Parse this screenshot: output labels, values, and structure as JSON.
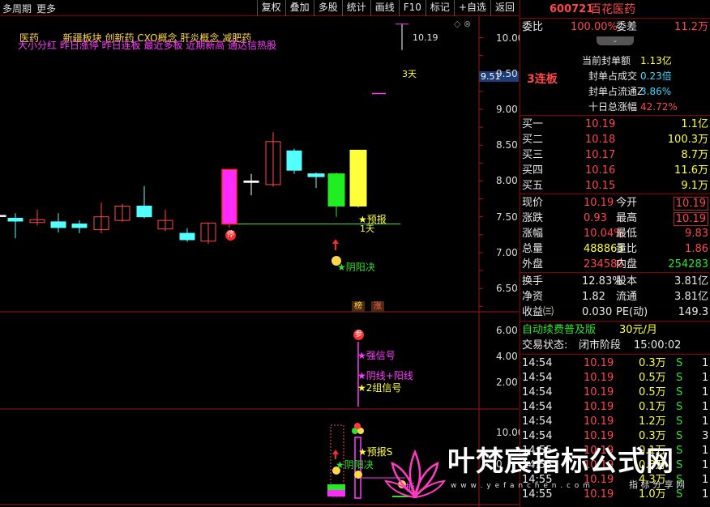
{
  "toolbar": {
    "period": "多周期",
    "more": "更多",
    "tools": [
      "复权",
      "叠加",
      "多股",
      "统计",
      "画线",
      "F10",
      "标记",
      "+自选",
      "返回"
    ]
  },
  "window_controls": "◇ ⊗",
  "chart": {
    "header_line1": {
      "sector": "医药",
      "concepts": "新疆板块  创新药 CXO概念 肝炎概念 减肥药"
    },
    "header_line2": "大小分红 昨日涨停 昨日连板 最近多板 近期新高 通达信热股",
    "price_labels": {
      "high_marker": "10.19",
      "limit_price": "9.51",
      "days": "3天",
      "forecast": "预报",
      "forecast_day": "1天",
      "yinyang": "阴阳决",
      "ting": "停",
      "b1": "榜",
      "b2": "涨"
    },
    "price_axis": [
      "10.00",
      "9.50",
      "9.00",
      "8.50",
      "8.00",
      "7.50",
      "7.00",
      "6.50"
    ],
    "signal_panel": {
      "badge": "参",
      "strong": "强信号",
      "yinyang_line": "阴线+阳线",
      "group": "2组信号",
      "axis": [
        "6.00",
        "4.00",
        "2.00"
      ]
    },
    "bottom_panel": {
      "forecast_s": "预报S",
      "yinyang": "阴阳决",
      "ban": "板",
      "axis": "10.00",
      "axis2": "0"
    },
    "chart_data": {
      "type": "candlestick",
      "ylim": [
        6.4,
        10.3
      ],
      "candles": [
        {
          "o": 7.52,
          "c": 7.52,
          "h": 7.62,
          "l": 7.35,
          "color": "white"
        },
        {
          "o": 7.44,
          "c": 7.48,
          "h": 7.55,
          "l": 7.2,
          "color": "cyan"
        },
        {
          "o": 7.42,
          "c": 7.46,
          "h": 7.6,
          "l": 7.38,
          "color": "red"
        },
        {
          "o": 7.43,
          "c": 7.35,
          "h": 7.55,
          "l": 7.28,
          "color": "cyan"
        },
        {
          "o": 7.4,
          "c": 7.35,
          "h": 7.45,
          "l": 7.27,
          "color": "cyan"
        },
        {
          "o": 7.32,
          "c": 7.5,
          "h": 7.7,
          "l": 7.27,
          "color": "red"
        },
        {
          "o": 7.45,
          "c": 7.65,
          "h": 7.68,
          "l": 7.43,
          "color": "red"
        },
        {
          "o": 7.65,
          "c": 7.5,
          "h": 7.93,
          "l": 7.48,
          "color": "cyan"
        },
        {
          "o": 7.33,
          "c": 7.45,
          "h": 7.6,
          "l": 7.3,
          "color": "red"
        },
        {
          "o": 7.27,
          "c": 7.18,
          "h": 7.34,
          "l": 7.15,
          "color": "cyan"
        },
        {
          "o": 7.16,
          "c": 7.41,
          "h": 7.42,
          "l": 7.12,
          "color": "red"
        },
        {
          "o": 7.4,
          "c": 8.15,
          "h": 8.16,
          "l": 7.35,
          "color": "magenta"
        },
        {
          "o": 7.98,
          "c": 8.0,
          "h": 8.1,
          "l": 7.8,
          "color": "white"
        },
        {
          "o": 7.95,
          "c": 8.55,
          "h": 8.68,
          "l": 7.92,
          "color": "red"
        },
        {
          "o": 8.42,
          "c": 8.15,
          "h": 8.45,
          "l": 8.1,
          "color": "cyan"
        },
        {
          "o": 8.1,
          "c": 8.06,
          "h": 8.12,
          "l": 7.9,
          "color": "cyan"
        },
        {
          "o": 7.65,
          "c": 8.1,
          "h": 8.12,
          "l": 7.5,
          "color": "green"
        },
        {
          "o": 7.65,
          "c": 8.43,
          "h": 8.43,
          "l": 7.63,
          "color": "yellow"
        }
      ],
      "support_level": 7.4,
      "future_marks": [
        {
          "price": 10.19
        },
        {
          "price": 9.22
        }
      ]
    }
  },
  "quote": {
    "code": "600721",
    "name": "百花医药",
    "weibi_label": "委比",
    "weibi": "100.00%",
    "weicha_label": "委差",
    "weicha": "11.2万",
    "streak": "3连板",
    "seal": [
      {
        "label": "当前封单额",
        "value": "1.13亿",
        "color": "yellow"
      },
      {
        "label": "封单占成交",
        "value": "0.23倍",
        "color": "cyan"
      },
      {
        "label": "封单占流通Z",
        "value": "3.86%",
        "color": "cyan"
      },
      {
        "label": "十日总涨幅",
        "value": "42.72%",
        "color": "red"
      }
    ],
    "buys": [
      {
        "label": "买一",
        "price": "10.19",
        "vol": "1.1亿"
      },
      {
        "label": "买二",
        "price": "10.18",
        "vol": "100.3万"
      },
      {
        "label": "买三",
        "price": "10.17",
        "vol": "8.7万"
      },
      {
        "label": "买四",
        "price": "10.16",
        "vol": "11.6万"
      },
      {
        "label": "买五",
        "price": "10.15",
        "vol": "9.1万"
      }
    ],
    "stats": [
      {
        "l1": "现价",
        "v1": "10.19",
        "c1": "red",
        "l2": "今开",
        "v2": "10.19",
        "c2": "red",
        "b2": true
      },
      {
        "l1": "涨跌",
        "v1": "0.93",
        "c1": "red",
        "l2": "最高",
        "v2": "10.19",
        "c2": "red",
        "b2": true
      },
      {
        "l1": "涨幅",
        "v1": "10.04%",
        "c1": "red",
        "l2": "最低",
        "v2": "9.83",
        "c2": "red"
      },
      {
        "l1": "总量",
        "v1": "488863",
        "c1": "yellow",
        "l2": "量比",
        "v2": "1.86",
        "c2": "red"
      },
      {
        "l1": "外盘",
        "v1": "234580",
        "c1": "red",
        "l2": "内盘",
        "v2": "254283",
        "c2": "green"
      }
    ],
    "stats2": [
      {
        "l1": "换手",
        "v1": "12.83%",
        "l2": "股本",
        "v2": "3.81亿"
      },
      {
        "l1": "净资",
        "v1": "1.82",
        "l2": "流通",
        "v2": "3.81亿"
      },
      {
        "l1": "收益㈢",
        "v1": "0.030",
        "l2": "PE(动)",
        "v2": "149.3"
      }
    ],
    "promo": "自动续费普及版",
    "promo_price": "30元/月",
    "trade_state_label": "交易状态:",
    "trade_state": "闭市阶段",
    "trade_time": "15:00:02",
    "ticks": [
      {
        "t": "14:54",
        "p": "10.19",
        "v": "0.3万",
        "s": "S",
        "n": "1"
      },
      {
        "t": "14:54",
        "p": "10.19",
        "v": "0.5万",
        "s": "S",
        "n": "1"
      },
      {
        "t": "14:54",
        "p": "10.19",
        "v": "0.5万",
        "s": "S",
        "n": "1"
      },
      {
        "t": "14:54",
        "p": "10.19",
        "v": "0.1万",
        "s": "S",
        "n": "1"
      },
      {
        "t": "14:54",
        "p": "10.19",
        "v": "1.2万",
        "s": "S",
        "n": "1"
      },
      {
        "t": "14:54",
        "p": "10.19",
        "v": "0.3万",
        "s": "S",
        "n": "3"
      },
      {
        "t": "14:55",
        "p": "10.19",
        "v": "0.1万",
        "s": "S",
        "n": "1"
      },
      {
        "t": "14:55",
        "p": "10.19",
        "v": "0.8万",
        "s": "S",
        "n": "1"
      },
      {
        "t": "14:55",
        "p": "10.19",
        "v": "4.3万",
        "s": "S",
        "n": "1"
      },
      {
        "t": "14:55",
        "p": "10.19",
        "v": "1.0万",
        "s": "S",
        "n": "1"
      }
    ]
  },
  "watermark": {
    "title": "叶梵宸指标公式网",
    "url": "w w w . y e f a n c h e n . c o m",
    "sub": "指 标 分 享 网"
  }
}
